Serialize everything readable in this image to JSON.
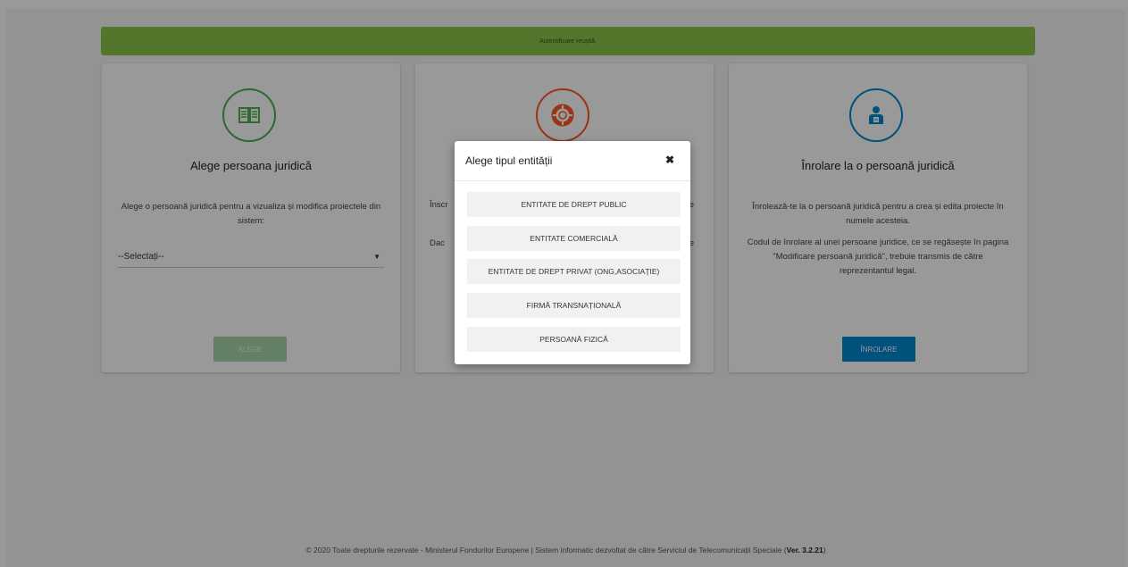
{
  "alert": {
    "text": "Autentificare reușită."
  },
  "cards": [
    {
      "title": "Alege persoana juridică",
      "text": [
        "Alege o persoană juridică pentru a vizualiza și modifica proiectele din sistem:"
      ],
      "select_value": "--Selectați--",
      "button": "ALEGE",
      "icon": "book-icon",
      "color": "#4caf50"
    },
    {
      "title": "",
      "text": [
        "Înscr",
        "Dac"
      ],
      "trailing": [
        "e",
        "e"
      ],
      "icon": "lifebuoy-icon",
      "color": "#ff5722"
    },
    {
      "title": "Înrolare la o persoană juridică",
      "text": [
        "Înrolează-te la o persoană juridică pentru a crea și edita proiecte în numele acesteia.",
        "Codul de înrolare al unei persoane juridice, ce se regăsește în pagina \"Modificare persoană juridică\", trebuie transmis de către reprezentantul legal."
      ],
      "button": "ÎNROLARE",
      "icon": "person-icon",
      "color": "#0288d1"
    }
  ],
  "modal": {
    "title": "Alege tipul entității",
    "close": "✖",
    "options": [
      "ENTITATE DE DREPT PUBLIC",
      "ENTITATE COMERCIALĂ",
      "ENTITATE DE DREPT PRIVAT (ONG,ASOCIAȚIE)",
      "FIRMĂ TRANSNAȚIONALĂ",
      "PERSOANĂ FIZICĂ"
    ]
  },
  "footer": {
    "text": "© 2020 Toate drepturile rezervate - Ministerul Fondurilor Europene | Sistem informatic dezvoltat de către Serviciul de Telecomunicații Speciale (",
    "version": "Ver. 3.2.21",
    "close": ")"
  }
}
